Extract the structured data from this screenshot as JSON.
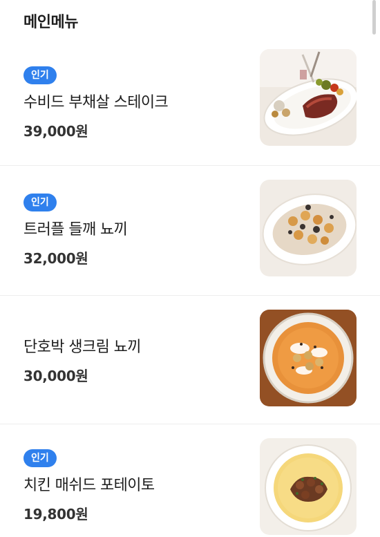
{
  "section": {
    "title": "메인메뉴"
  },
  "menu": [
    {
      "badge": "인기",
      "name": "수비드 부채살 스테이크",
      "price": "39,000원",
      "image_icon": "steak-plate-icon"
    },
    {
      "badge": "인기",
      "name": "트러플 들깨 뇨끼",
      "price": "32,000원",
      "image_icon": "gnocchi-truffle-icon"
    },
    {
      "badge": "",
      "name": "단호박 생크림 뇨끼",
      "price": "30,000원",
      "image_icon": "pumpkin-gnocchi-icon"
    },
    {
      "badge": "인기",
      "name": "치킨 매쉬드 포테이토",
      "price": "19,800원",
      "image_icon": "chicken-mashed-potato-icon"
    }
  ],
  "colors": {
    "badge": "#2f80ed",
    "divider": "#eeeeee",
    "text": "#1e1e1e"
  }
}
